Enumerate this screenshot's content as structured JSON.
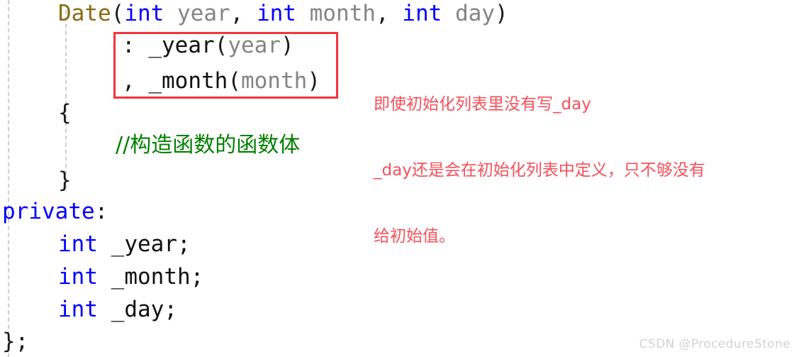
{
  "editor": {
    "background_color": "#ffffff",
    "indent_guide_color": "#cfcfcf",
    "code": {
      "signature": {
        "func_name": "Date",
        "paren_open": "(",
        "type1": "int",
        "param1": " year",
        "comma1": ", ",
        "type2": "int",
        "param2": " month",
        "comma2": ", ",
        "type3": "int",
        "param3": " day",
        "paren_close": ")"
      },
      "init_year": {
        "colon": ": ",
        "member": "_year",
        "paren_open": "(",
        "arg": "year",
        "paren_close": ")"
      },
      "init_month": {
        "comma": ", ",
        "member": "_month",
        "paren_open": "(",
        "arg": "month",
        "paren_close": ")"
      },
      "open_brace": "{",
      "body_comment": "//构造函数的函数体",
      "close_brace": "}",
      "access_specifier": {
        "keyword": "private",
        "colon": ":"
      },
      "member_year": {
        "type": "int",
        "name": " _year;"
      },
      "member_month": {
        "type": "int",
        "name": " _month;"
      },
      "member_day": {
        "type": "int",
        "name": " _day;"
      },
      "class_end": "};"
    },
    "syntax_colors": {
      "keyword": "#0000ff",
      "type": "#0000ff",
      "function": "#8a6a10",
      "parameter": "#848484",
      "comment": "#008000",
      "plain": "#1a1a1a"
    }
  },
  "highlight_box": {
    "color": "#f5333c",
    "border_width_px": 3
  },
  "annotation": {
    "color": "#f5505a",
    "lines": [
      "即使初始化列表里没有写_day",
      "_day还是会在初始化列表中定义，只不够没有",
      "给初始值。"
    ]
  },
  "watermark": {
    "text": "CSDN @ProcedureStone",
    "color": "#d2d2d2"
  }
}
